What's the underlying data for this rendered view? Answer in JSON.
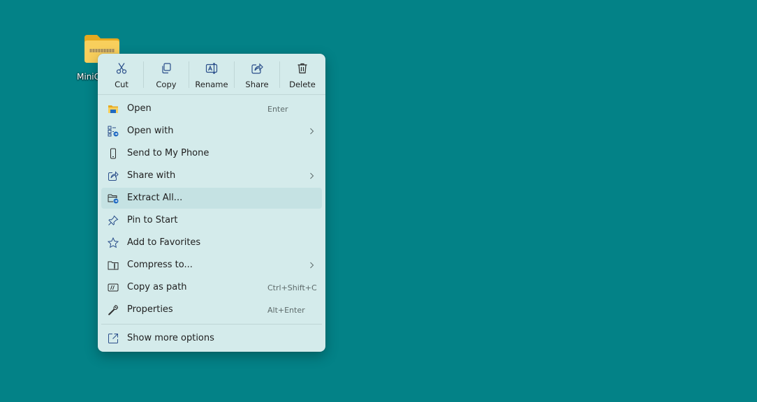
{
  "desktop": {
    "background_color": "#038287",
    "icon": {
      "label": "MiniC",
      "icon_name": "zip-folder-icon"
    }
  },
  "context_menu": {
    "background_color": "#d4ebeb",
    "accent_color": "#1f6ac2",
    "toolbar": [
      {
        "label": "Cut",
        "icon": "scissors-icon"
      },
      {
        "label": "Copy",
        "icon": "copy-icon"
      },
      {
        "label": "Rename",
        "icon": "rename-icon"
      },
      {
        "label": "Share",
        "icon": "share-icon"
      },
      {
        "label": "Delete",
        "icon": "trash-icon"
      }
    ],
    "items": [
      {
        "label": "Open",
        "shortcut": "Enter",
        "icon": "folder-open-icon"
      },
      {
        "label": "Open with",
        "shortcut": "",
        "icon": "open-with-icon",
        "submenu": true
      },
      {
        "label": "Send to My Phone",
        "shortcut": "",
        "icon": "phone-icon"
      },
      {
        "label": "Share with",
        "shortcut": "",
        "icon": "share-icon",
        "submenu": true
      },
      {
        "label": "Extract All...",
        "shortcut": "",
        "icon": "extract-icon",
        "highlighted": true
      },
      {
        "label": "Pin to Start",
        "shortcut": "",
        "icon": "pin-icon"
      },
      {
        "label": "Add to Favorites",
        "shortcut": "",
        "icon": "star-icon"
      },
      {
        "label": "Compress to...",
        "shortcut": "",
        "icon": "compress-icon",
        "submenu": true
      },
      {
        "label": "Copy as path",
        "shortcut": "Ctrl+Shift+C",
        "icon": "copy-path-icon"
      },
      {
        "label": "Properties",
        "shortcut": "Alt+Enter",
        "icon": "wrench-icon"
      }
    ],
    "more_options": {
      "label": "Show more options",
      "icon": "external-link-icon"
    }
  }
}
